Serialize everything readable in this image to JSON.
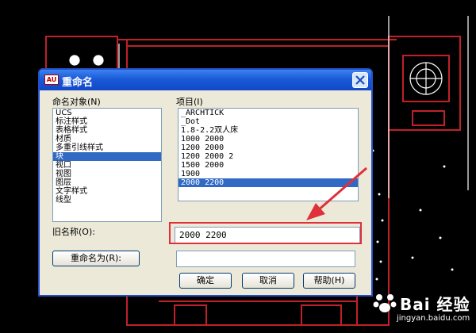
{
  "dialog": {
    "title": "重命名",
    "app_icon_text": "AU",
    "left_label": "命名对象(N)",
    "right_label": "项目(I)",
    "objects": [
      "UCS",
      "标注样式",
      "表格样式",
      "材质",
      "多重引线样式",
      "块",
      "视口",
      "视图",
      "图层",
      "文字样式",
      "线型"
    ],
    "selected_object": "块",
    "items": [
      "_ARCHTICK",
      "_Dot",
      "1.8-2.2双人床",
      "1000 2000",
      "1200 2000",
      "1200 2000 2",
      "1500 2000",
      "1900",
      "2000 2200"
    ],
    "selected_item": "2000 2200",
    "old_name_label": "旧名称(O):",
    "old_name_value": "2000 2200",
    "rename_to_button": "重命名为(R):",
    "rename_to_value": "",
    "ok_button": "确定",
    "cancel_button": "取消",
    "help_button": "帮助(H)"
  },
  "watermark": {
    "brand": "Bai 经验",
    "url": "jingyan.baidu.com"
  },
  "colors": {
    "cad_line": "#c0202a",
    "annotation": "#e0303a",
    "selection": "#316ac5"
  }
}
